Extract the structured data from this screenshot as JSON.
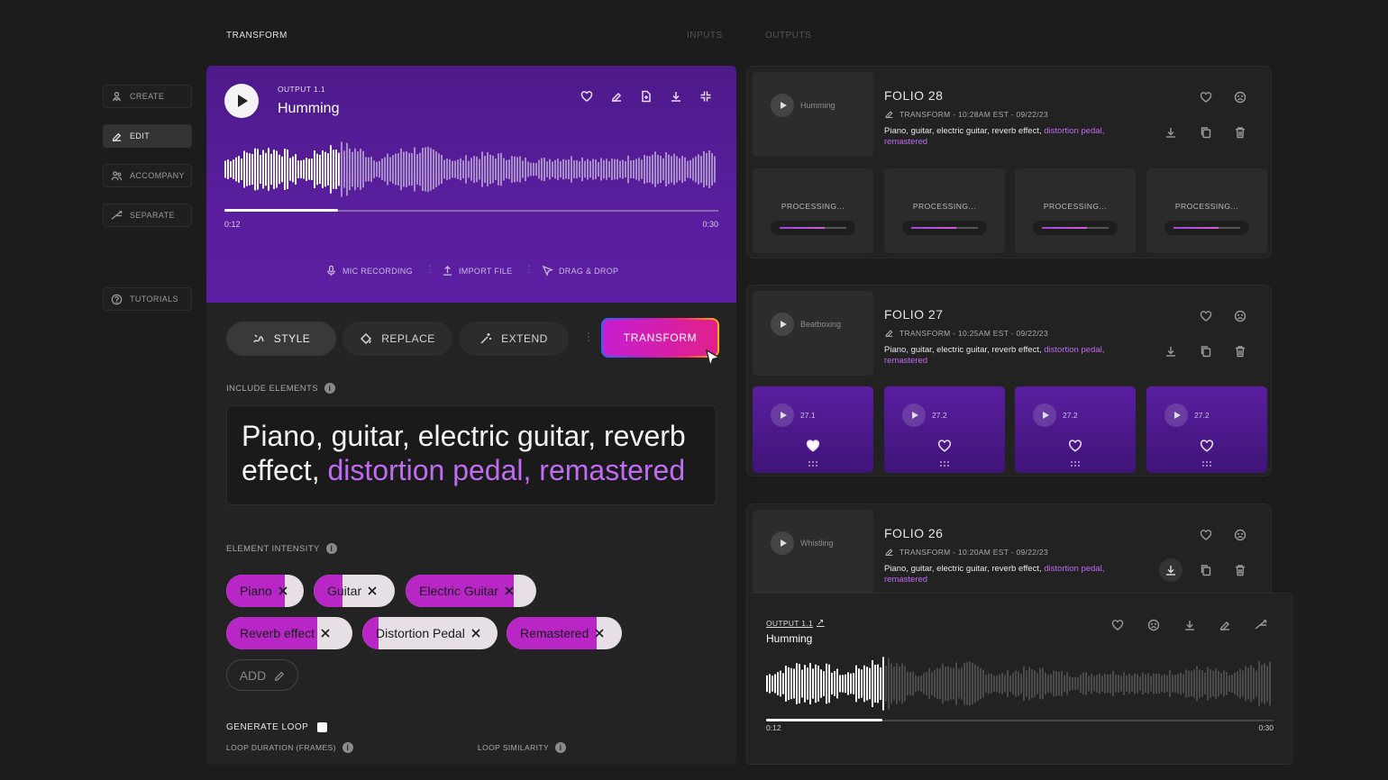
{
  "nav": {
    "title": "TRANSFORM",
    "inputs": "INPUTS",
    "outputs": "OUTPUTS"
  },
  "sidebar": [
    {
      "label": "CREATE",
      "icon": "create-icon"
    },
    {
      "label": "EDIT",
      "icon": "edit-icon",
      "active": true
    },
    {
      "label": "ACCOMPANY",
      "icon": "accompany-icon"
    },
    {
      "label": "SEPARATE",
      "icon": "separate-icon"
    },
    {
      "label": "TUTORIALS",
      "icon": "help-icon"
    }
  ],
  "player": {
    "output_label": "OUTPUT 1.1",
    "name": "Humming",
    "time_current": "0:12",
    "time_total": "0:30",
    "progress": 0.23,
    "icons": [
      "heart-icon",
      "pencil-icon",
      "file-add-icon",
      "download-icon",
      "collapse-icon"
    ],
    "upload": {
      "mic": "MIC RECORDING",
      "import": "IMPORT FILE",
      "drag": "DRAG & DROP"
    }
  },
  "tabs": {
    "style": "STYLE",
    "replace": "REPLACE",
    "extend": "EXTEND",
    "transform": "TRANSFORM"
  },
  "include": {
    "label": "INCLUDE ELEMENTS",
    "text_plain": "Piano, guitar, electric guitar, reverb effect, ",
    "text_highlight": "distortion pedal, remastered"
  },
  "intensity": {
    "label": "ELEMENT INTENSITY",
    "chips": [
      {
        "label": "Piano",
        "level": 0.75
      },
      {
        "label": "Guitar",
        "level": 0.35
      },
      {
        "label": "Electric Guitar",
        "level": 0.83
      },
      {
        "label": "Reverb effect",
        "level": 0.72
      },
      {
        "label": "Distortion Pedal",
        "level": 0.12
      },
      {
        "label": "Remastered",
        "level": 0.78
      }
    ],
    "add_label": "ADD"
  },
  "loop": {
    "generate": "GENERATE LOOP",
    "duration": "LOOP DURATION (FRAMES)",
    "similarity": "LOOP SIMILARITY"
  },
  "folios": [
    {
      "title": "FOLIO 28",
      "thumb": "Humming",
      "meta": "TRANSFORM - 10:28AM EST - 09/22/23",
      "desc_plain": "Piano, guitar, electric guitar, reverb effect, ",
      "desc_highlight": "distortion pedal, remastered",
      "processing": [
        "PROCESSING...",
        "PROCESSING...",
        "PROCESSING...",
        "PROCESSING..."
      ]
    },
    {
      "title": "FOLIO 27",
      "thumb": "Beatboxing",
      "meta": "TRANSFORM - 10:25AM EST - 09/22/23",
      "desc_plain": "Piano, guitar, electric guitar, reverb effect, ",
      "desc_highlight": "distortion pedal, remastered",
      "variants": [
        {
          "label": "27.1",
          "liked": true
        },
        {
          "label": "27.2",
          "liked": false
        },
        {
          "label": "27.2",
          "liked": false
        },
        {
          "label": "27.2",
          "liked": false
        }
      ]
    },
    {
      "title": "FOLIO 26",
      "thumb": "Whistling",
      "meta": "TRANSFORM - 10:20AM EST - 09/22/23",
      "desc_plain": "Piano, guitar, electric guitar, reverb effect, ",
      "desc_highlight": "distortion pedal, remastered"
    }
  ],
  "mini_player": {
    "output_label": "OUTPUT 1.1",
    "name": "Humming",
    "time_current": "0:12",
    "time_total": "0:30",
    "progress": 0.23
  },
  "colors": {
    "accent": "#b826c6",
    "purple": "#5a1e9e",
    "highlight": "#bf6cf2"
  }
}
